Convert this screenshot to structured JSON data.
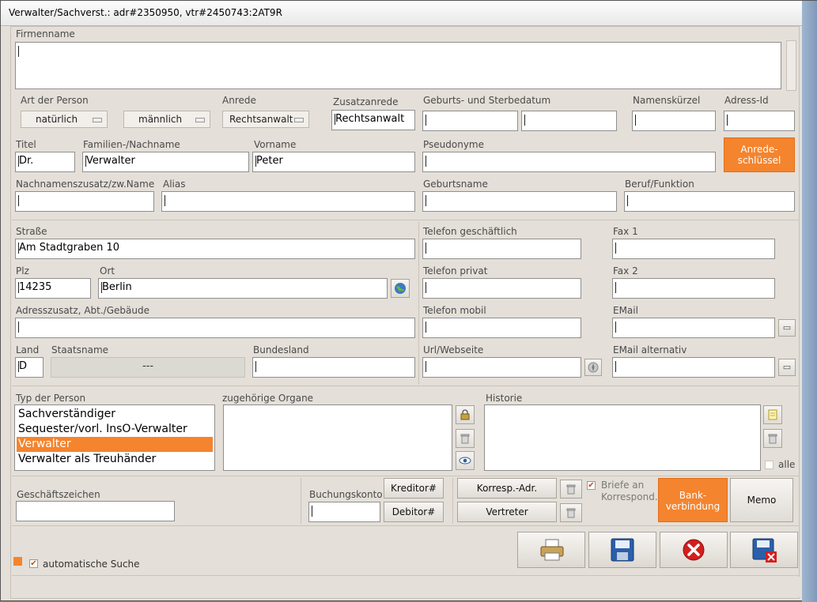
{
  "window": {
    "title": "Verwalter/Sachverst.: adr#2350950, vtr#2450743:2AT9R"
  },
  "labels": {
    "firmenname": "Firmenname",
    "art": "Art der Person",
    "anrede": "Anrede",
    "zusatzanrede": "Zusatzanrede",
    "geburt": "Geburts- und Sterbedatum",
    "namenskuerzel": "Namenskürzel",
    "adressid": "Adress-Id",
    "titel": "Titel",
    "familienname": "Familien-/Nachname",
    "vorname": "Vorname",
    "pseudonyme": "Pseudonyme",
    "nachnamenszusatz": "Nachnamenszusatz/zw.Name",
    "alias": "Alias",
    "geburtsname": "Geburtsname",
    "beruf": "Beruf/Funktion",
    "strasse": "Straße",
    "tel_geschaeft": "Telefon geschäftlich",
    "fax1": "Fax 1",
    "plz": "Plz",
    "ort": "Ort",
    "tel_privat": "Telefon privat",
    "fax2": "Fax 2",
    "adresszusatz": "Adresszusatz, Abt./Gebäude",
    "tel_mobil": "Telefon mobil",
    "email": "EMail",
    "land": "Land",
    "staatsname": "Staatsname",
    "bundesland": "Bundesland",
    "url": "Url/Webseite",
    "email_alt": "EMail alternativ",
    "typ": "Typ der Person",
    "organe": "zugehörige Organe",
    "historie": "Historie",
    "alle": "alle",
    "geschaeftszeichen": "Geschäftszeichen",
    "buchungskonto": "Buchungskonto",
    "briefe1": "Briefe an",
    "briefe2": "Korrespond.",
    "autosuche": "automatische Suche"
  },
  "values": {
    "firmenname": "",
    "art": "natürlich",
    "geschlecht": "männlich",
    "anrede": "Rechtsanwalt",
    "zusatzanrede": "Rechtsanwalt",
    "titel": "Dr.",
    "familienname": "Verwalter",
    "vorname": "Peter",
    "strasse": "Am Stadtgraben 10",
    "plz": "14235",
    "ort": "Berlin",
    "land": "D",
    "staatsname": "---"
  },
  "buttons": {
    "anredeschluessel_1": "Anrede-",
    "anredeschluessel_2": "schlüssel",
    "kreditor": "Kreditor#",
    "debitor": "Debitor#",
    "korresp": "Korresp.-Adr.",
    "vertreter": "Vertreter",
    "bank_1": "Bank-",
    "bank_2": "verbindung",
    "memo": "Memo"
  },
  "typ_list": [
    {
      "label": "Sachverständiger",
      "selected": false
    },
    {
      "label": "Sequester/vorl. InsO-Verwalter",
      "selected": false
    },
    {
      "label": "Verwalter",
      "selected": true
    },
    {
      "label": "Verwalter als Treuhänder",
      "selected": false
    }
  ],
  "checkboxes": {
    "alle": false,
    "briefe": true,
    "autosuche": true
  },
  "icons": [
    "globe-icon",
    "lock-icon",
    "trash-icon",
    "eye-icon",
    "note-icon",
    "print-icon",
    "save-icon",
    "cancel-icon",
    "save-close-icon",
    "compass-icon",
    "mail-icon"
  ],
  "colors": {
    "accent": "#f4842e",
    "panel": "#e4dfd8"
  }
}
